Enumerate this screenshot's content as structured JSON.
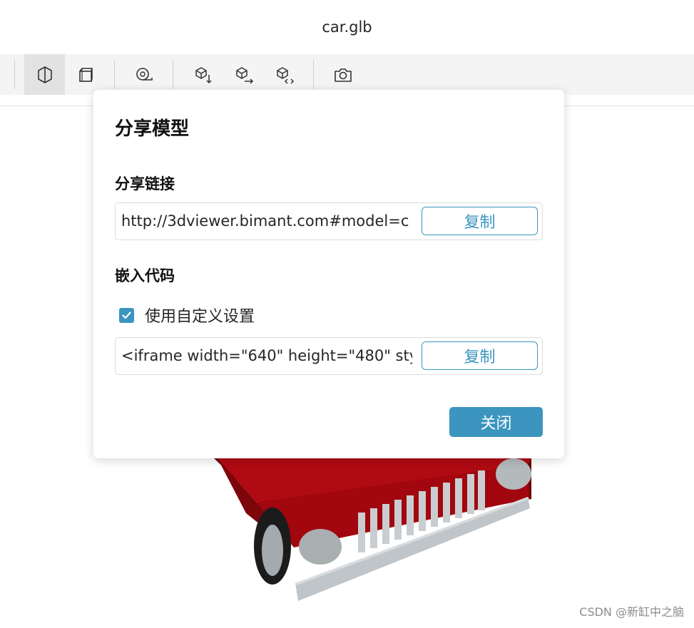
{
  "window": {
    "title": "car.glb"
  },
  "toolbar": {
    "buttons": [
      {
        "name": "shaded-view-icon",
        "active": true
      },
      {
        "name": "wireframe-view-icon",
        "active": false
      },
      {
        "name": "measure-tool-icon",
        "active": false
      },
      {
        "name": "import-model-icon",
        "active": false
      },
      {
        "name": "export-model-icon",
        "active": false
      },
      {
        "name": "embed-model-icon",
        "active": false
      },
      {
        "name": "snapshot-icon",
        "active": false
      }
    ]
  },
  "dialog": {
    "title": "分享模型",
    "share_link": {
      "section_title": "分享链接",
      "value": "http://3dviewer.bimant.com#model=c",
      "copy_label": "复制"
    },
    "embed_code": {
      "section_title": "嵌入代码",
      "custom_settings_label": "使用自定义设置",
      "custom_settings_checked": true,
      "value": "<iframe width=\"640\" height=\"480\" sty",
      "copy_label": "复制"
    },
    "close_label": "关闭"
  },
  "watermark": "CSDN @新缸中之脑",
  "colors": {
    "accent": "#3b95bf",
    "toolbar_bg": "#f4f4f4",
    "car_body": "#a8070f"
  }
}
